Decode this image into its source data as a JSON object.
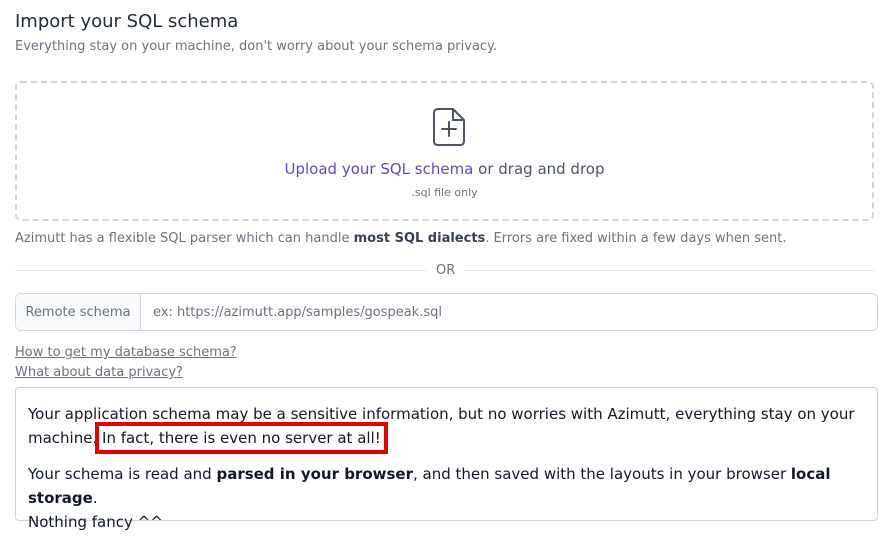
{
  "header": {
    "title": "Import your SQL schema",
    "subtitle": "Everything stay on your machine, don't worry about your schema privacy."
  },
  "upload": {
    "icon": "file-plus-icon",
    "link_text": "Upload your SQL schema",
    "drag_text": " or drag and drop",
    "file_note": ".sql file only"
  },
  "parser_note": {
    "prefix": "Azimutt has a flexible SQL parser which can handle ",
    "bold": "most SQL dialects",
    "suffix": ". Errors are fixed within a few days when sent."
  },
  "divider": {
    "label": "OR"
  },
  "remote": {
    "label": "Remote schema",
    "placeholder": "ex: https://azimutt.app/samples/gospeak.sql",
    "value": ""
  },
  "links": {
    "get_schema": "How to get my database schema?",
    "data_privacy": "What about data privacy?"
  },
  "info": {
    "p1_text": "Your application schema may be a sensitive information, but no worries with Azimutt, everything stay on your machine.",
    "p1_highlight": "In fact, there is even no server at all!",
    "p2_a": "Your schema is read and ",
    "p2_b": "parsed in your browser",
    "p2_c": ", and then saved with the layouts in your browser ",
    "p2_d": "local storage",
    "p2_e": ".",
    "p2_f": "Nothing fancy ^^"
  },
  "colors": {
    "accent": "#5b4cc4",
    "highlight_border": "#e60000",
    "muted_text": "#6b7280"
  }
}
